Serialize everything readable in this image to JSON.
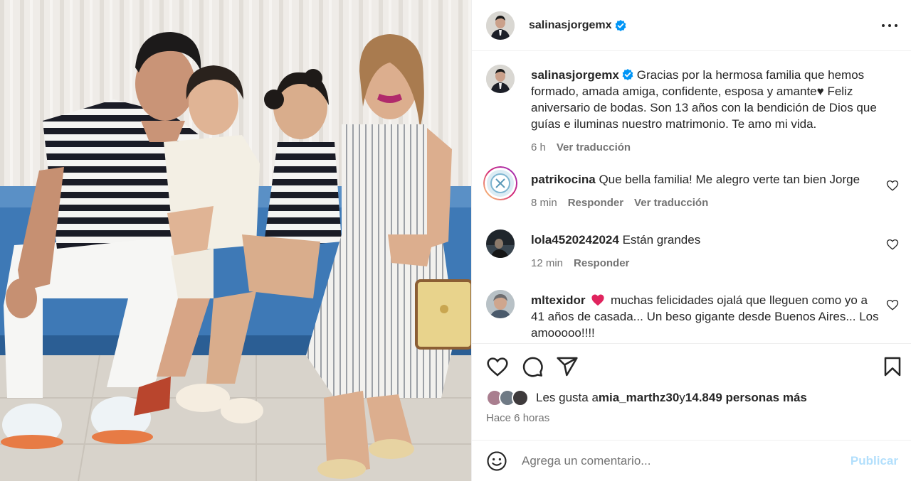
{
  "post": {
    "username": "salinasjorgemx",
    "verified": true,
    "more_icon": "more-horizontal-icon"
  },
  "caption": {
    "username": "salinasjorgemx",
    "text_1": "Gracias por la hermosa familia que hemos formado, amada amiga, confidente, esposa y amante",
    "heart": "♥",
    "text_2": " Feliz aniversario de bodas. Son 13 años con la bendición de Dios que guías e iluminas nuestro matrimonio. Te amo mi vida.",
    "age": "6 h",
    "translate": "Ver traducción"
  },
  "comments": [
    {
      "username": "patrikocina",
      "text": "Que bella familia! Me alegro verte tan bien Jorge",
      "age": "8 min",
      "reply": "Responder",
      "translate": "Ver traducción"
    },
    {
      "username": "lola4520242024",
      "text": "Están grandes",
      "age": "12 min",
      "reply": "Responder"
    },
    {
      "username": "mltexidor",
      "text": "muchas felicidades ojalá que lleguen como yo a 41 años de casada... Un beso gigante desde Buenos Aires... Los amooooo!!!!"
    }
  ],
  "likes": {
    "prefix": "Les gusta a ",
    "user": "mia_marthz30",
    "middle": " y ",
    "others": "14.849 personas más"
  },
  "timestamp": "Hace 6 horas",
  "compose": {
    "placeholder": "Agrega un comentario...",
    "post_label": "Publicar"
  },
  "colors": {
    "accent_verified": "#0095f6",
    "post_disabled": "#b2dffc",
    "secondary_text": "#737373",
    "heart_red": "#e0245e"
  }
}
